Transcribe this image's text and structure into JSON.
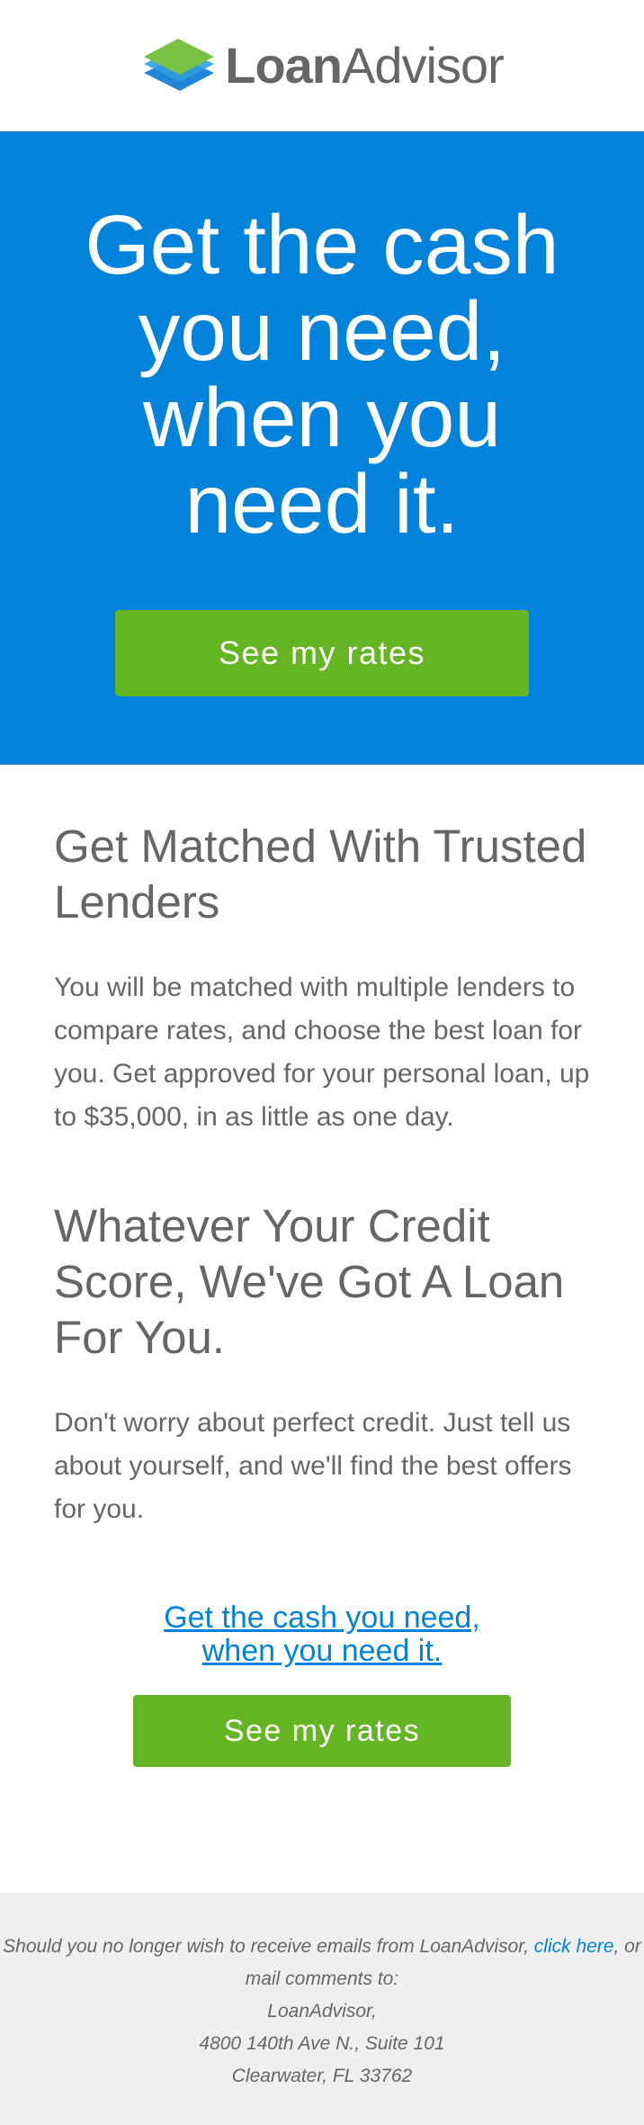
{
  "header": {
    "logo_bold": "Loan",
    "logo_light": "Advisor"
  },
  "hero": {
    "title": "Get the cash you need, when you need it.",
    "button_label": "See my rates"
  },
  "sections": [
    {
      "title": "Get Matched With Trusted Lenders",
      "body": "You will be matched with multiple lenders to compare rates, and choose the best loan for you. Get approved for your personal loan, up to $35,000, in as little as one day."
    },
    {
      "title": "Whatever Your Credit Score, We've Got A Loan For You.",
      "body": "Don't worry about perfect credit. Just tell us about yourself, and we'll find the best offers for you."
    }
  ],
  "cta": {
    "link_text": "Get the cash you need, when you need it.",
    "button_label": "See my rates"
  },
  "footer": {
    "line1_prefix": "Should you no longer wish to receive emails from LoanAdvisor, ",
    "unsubscribe_link": "click here",
    "line1_suffix": ", or mail comments to:",
    "company": "LoanAdvisor,",
    "address1": "4800 140th Ave N., Suite 101",
    "address2": "Clearwater, FL 33762"
  },
  "colors": {
    "brand_blue": "#0183dc",
    "cta_green": "#65b422",
    "logo_green": "#7ac143",
    "logo_blue": "#1f86d8",
    "text_gray": "#666666",
    "footer_bg": "#efefef"
  }
}
